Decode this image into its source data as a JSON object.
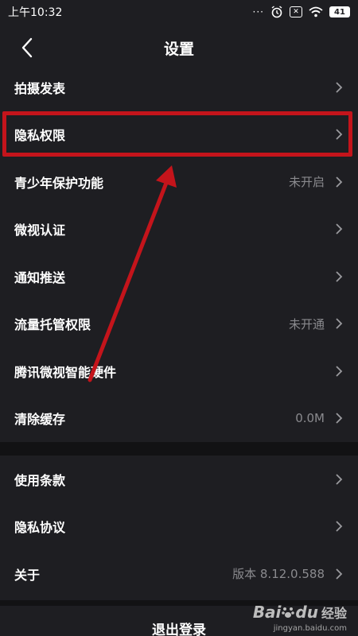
{
  "status_bar": {
    "time": "上午10:32",
    "signal_dots": "···",
    "alarm_icon": "alarm-icon",
    "sim_icon": "sim-x-icon",
    "wifi_icon": "wifi-icon",
    "battery": "41"
  },
  "header": {
    "title": "设置",
    "back_icon": "back-chevron-icon"
  },
  "settings_group1": [
    {
      "label": "拍摄发表",
      "value": ""
    },
    {
      "label": "隐私权限",
      "value": ""
    },
    {
      "label": "青少年保护功能",
      "value": "未开启"
    },
    {
      "label": "微视认证",
      "value": ""
    },
    {
      "label": "通知推送",
      "value": ""
    },
    {
      "label": "流量托管权限",
      "value": "未开通"
    },
    {
      "label": "腾讯微视智能硬件",
      "value": ""
    },
    {
      "label": "清除缓存",
      "value": "0.0M"
    }
  ],
  "settings_group2": [
    {
      "label": "使用条款",
      "value": ""
    },
    {
      "label": "隐私协议",
      "value": ""
    },
    {
      "label": "关于",
      "value": "版本 8.12.0.588"
    }
  ],
  "logout_label": "退出登录",
  "annotation": {
    "highlight_color": "#c4141b"
  },
  "watermark": {
    "brand": "Bai",
    "brand2": "du",
    "jingyan": "经验",
    "url": "jingyan.baidu.com"
  },
  "colors": {
    "background": "#1e1e22",
    "separator": "#121214",
    "text_primary": "#ffffff",
    "text_secondary": "#8a8a8e"
  }
}
